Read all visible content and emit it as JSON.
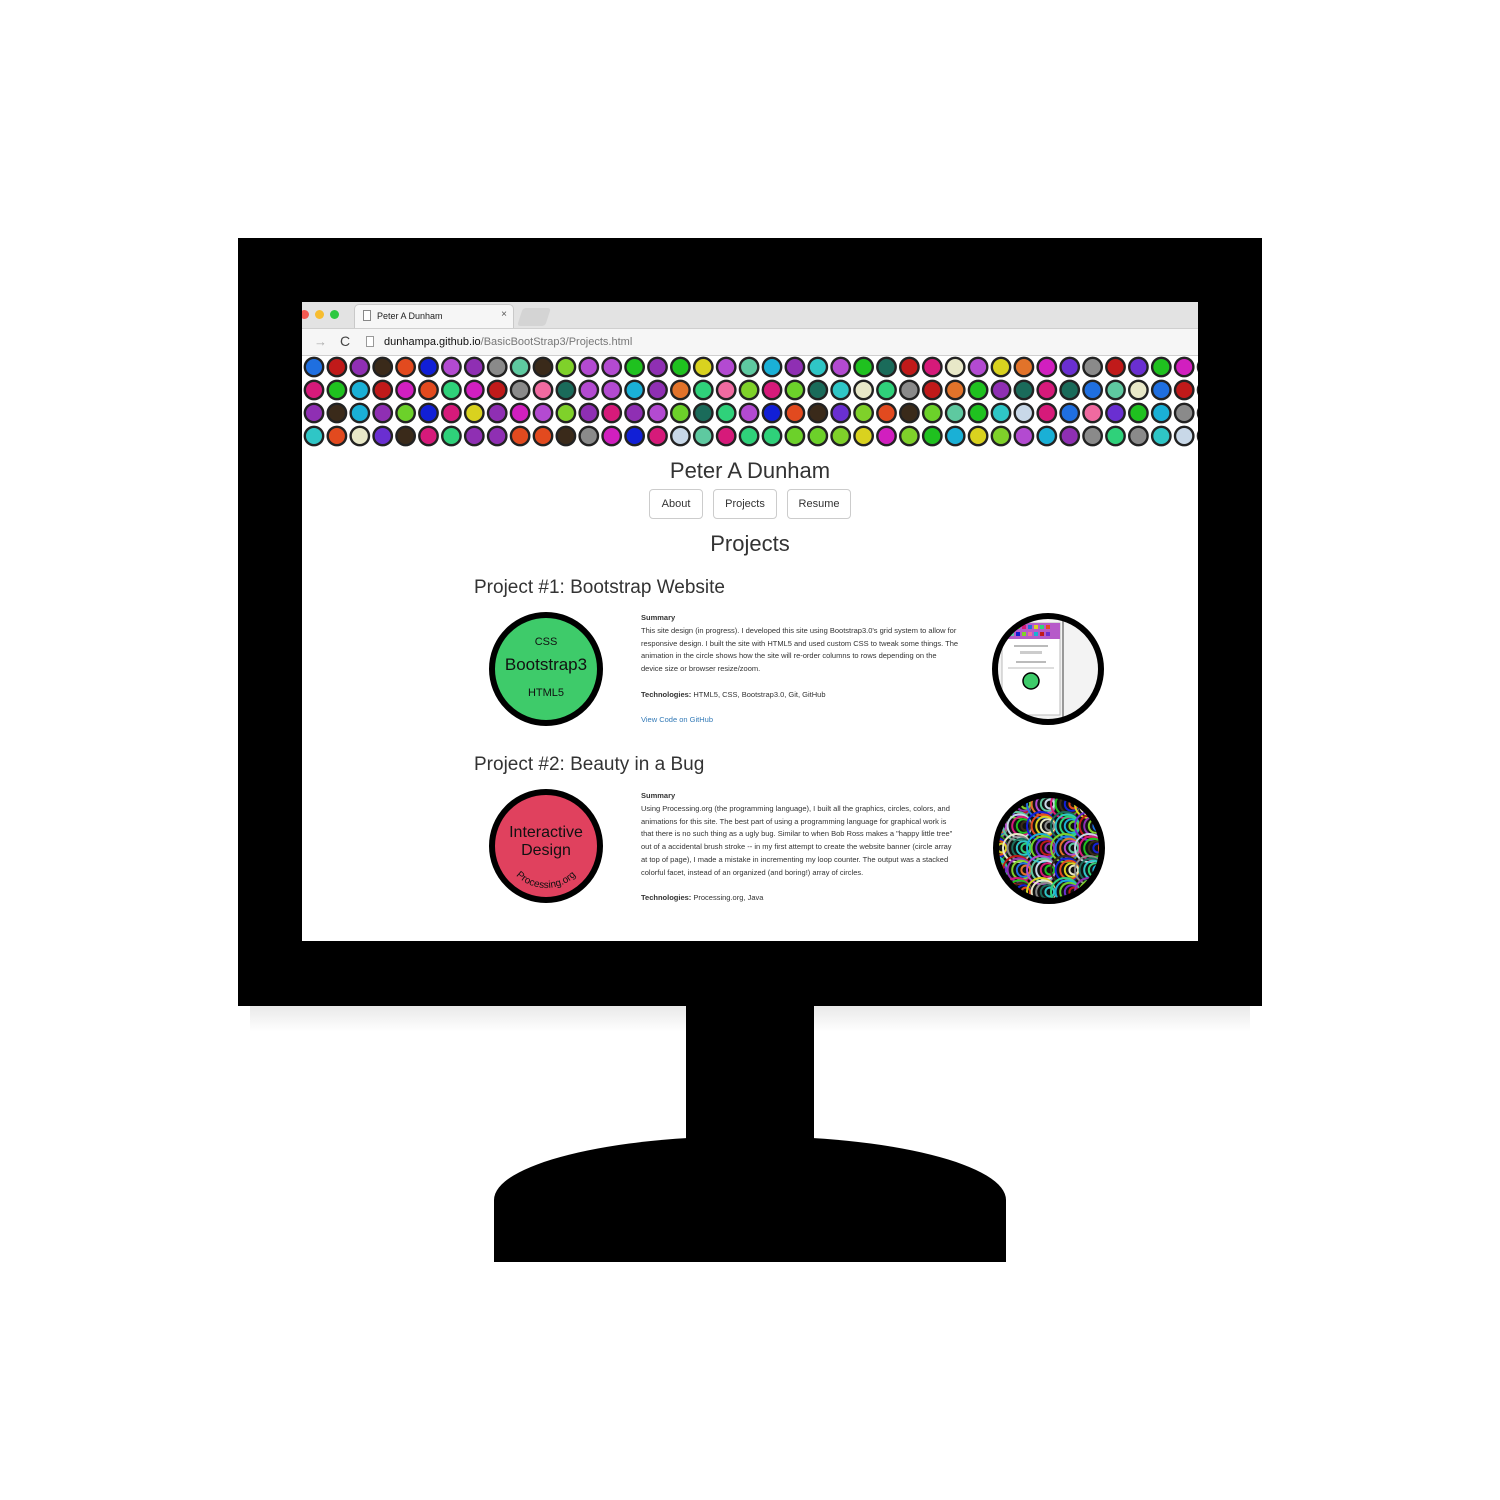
{
  "browser": {
    "tab_title": "Peter A Dunham",
    "tab_close": "×",
    "url_host": "dunhampa.github.io",
    "url_path": "/BasicBootStrap3/Projects.html",
    "nav_forward": "→",
    "nav_reload": "C"
  },
  "banner": {
    "dot_rows": 4,
    "dot_colors": [
      "#2fc6c6",
      "#1f6fe0",
      "#d11fbf",
      "#e8e8c8",
      "#5ec9a0",
      "#1a6b5a",
      "#6cd12a",
      "#6a2fd1",
      "#d61a7a",
      "#8a8a8a",
      "#e24a1f",
      "#2fd17a",
      "#d9d21f",
      "#111fd6",
      "#c01a1a",
      "#7fd12a",
      "#c8d8e8",
      "#8f2fb3",
      "#e2732a",
      "#1ab0d6",
      "#3a2a1a",
      "#1fc11f",
      "#b34ad1",
      "#f06aa0"
    ]
  },
  "site": {
    "title": "Peter A Dunham",
    "nav": [
      "About",
      "Projects",
      "Resume"
    ],
    "section_heading": "Projects"
  },
  "projects": [
    {
      "title": "Project #1: Bootstrap Website",
      "summary_label": "Summary",
      "summary": "This site design (in progress). I developed this site using Bootstrap3.0's grid system to allow for responsive design. I built the site with HTML5 and used custom CSS to tweak some things. The animation in the circle shows how the site will re-order columns to rows depending on the device size or browser resize/zoom.",
      "tech_label": "Technologies:",
      "tech": "HTML5, CSS, Bootstrap3.0, Git, GitHub",
      "link": "View Code on GitHub",
      "badge_top": "CSS",
      "badge_mid": "Bootstrap3",
      "badge_bottom": "HTML5",
      "badge_color": "#3ecb6a"
    },
    {
      "title": "Project #2: Beauty in a Bug",
      "summary_label": "Summary",
      "summary": "Using Processing.org (the programming language), I built all the graphics, circles, colors, and animations for this site. The best part of using a programming language for graphical work is that there is no such thing as a ugly bug. Similar to when Bob Ross makes a \"happy little tree\" out of a accidental brush stroke -- in my first attempt to create the website banner (circle array at top of page), I made a mistake in incrementing my loop counter. The output was a stacked colorful facet, instead of an organized (and boring!) array of circles.",
      "tech_label": "Technologies:",
      "tech": "Processing.org, Java",
      "badge_line1": "Interactive",
      "badge_line2": "Design",
      "badge_arc": "Processing.org",
      "badge_color": "#e0415e"
    }
  ]
}
